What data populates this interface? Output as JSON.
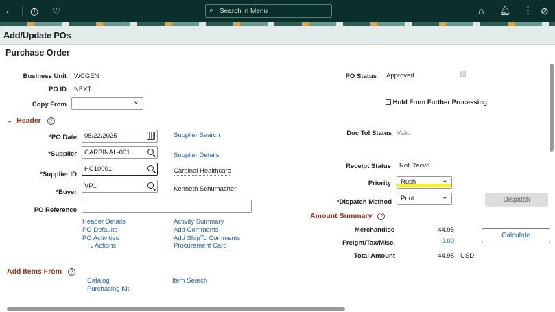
{
  "topbar": {
    "search_placeholder": "Search in Menu"
  },
  "page_title": "Add/Update POs",
  "section_title": "Purchase Order",
  "business_unit": {
    "label": "Business Unit",
    "value": "WCGEN"
  },
  "po_id": {
    "label": "PO ID",
    "value": "NEXT"
  },
  "copy_from": {
    "label": "Copy From",
    "value": ""
  },
  "header": {
    "label": "Header"
  },
  "po_date": {
    "label": "*PO Date",
    "value": "08/22/2025"
  },
  "supplier": {
    "label": "*Supplier",
    "value": "CARBINAL-001"
  },
  "supplier_id": {
    "label": "*Supplier ID",
    "value": "HC10001",
    "name": "Carbinal Healthcare"
  },
  "buyer": {
    "label": "*Buyer",
    "value": "VP1",
    "name": "Kenneth Schumacher"
  },
  "po_reference": {
    "label": "PO Reference",
    "value": ""
  },
  "links": {
    "supplier_search": "Supplier Search",
    "supplier_details": "Supplier Details",
    "header_details": "Header Details",
    "po_defaults": "PO Defaults",
    "po_activities": "PO Activities",
    "actions": "Actions",
    "activity_summary": "Activity Summary",
    "add_comments": "Add Comments",
    "add_shipto_comments": "Add ShipTo Comments",
    "procurement_card": "Procurement Card"
  },
  "po_status": {
    "label": "PO Status",
    "value": "Approved"
  },
  "hold": {
    "label": "Hold From Further Processing",
    "checked": false
  },
  "doc_tol": {
    "label": "Doc Tol Status",
    "value": "Valid"
  },
  "receipt": {
    "label": "Receipt Status",
    "value": "Not Recvd"
  },
  "priority": {
    "label": "Priority",
    "value": "Rush"
  },
  "dispatch_method": {
    "label": "*Dispatch Method",
    "value": "Print"
  },
  "dispatch_button": "Dispatch",
  "amount_summary": {
    "label": "Amount Summary",
    "merch_label": "Merchandise",
    "merch": "44.95",
    "freight_label": "Freight/Tax/Misc.",
    "freight": "0.00",
    "total_label": "Total Amount",
    "total": "44.95",
    "currency": "USD",
    "calculate": "Calculate"
  },
  "add_items": {
    "label": "Add Items From",
    "catalog": "Catalog",
    "purchasing_kit": "Purchasing Kit",
    "item_search": "Item Search"
  }
}
